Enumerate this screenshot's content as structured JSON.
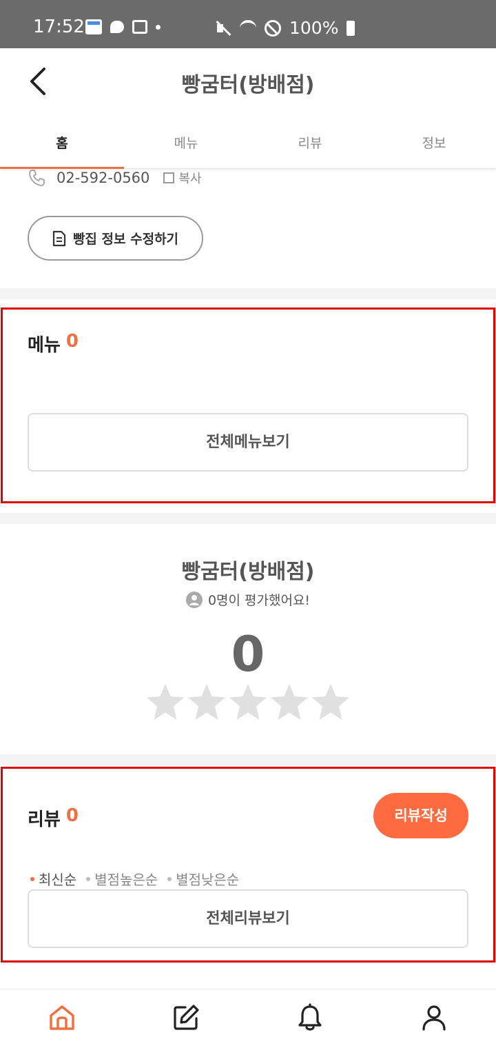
{
  "status_bar": {
    "time": "17:52",
    "battery": "100%",
    "icons": [
      "calendar-icon",
      "chat-bubble-icon",
      "gift-icon",
      "dot-icon",
      "mute-icon",
      "wifi-icon",
      "block-icon",
      "battery-icon"
    ]
  },
  "header": {
    "title": "빵굼터(방배점)",
    "back_icon": "chevron-left-icon"
  },
  "tabs": [
    {
      "label": "홈",
      "active": true
    },
    {
      "label": "메뉴",
      "active": false
    },
    {
      "label": "리뷰",
      "active": false
    },
    {
      "label": "정보",
      "active": false
    }
  ],
  "info": {
    "phone": "02-592-0560",
    "copy_label": "복사",
    "edit_button": "빵집 정보 수정하기"
  },
  "menu_section": {
    "title": "메뉴",
    "count": "0",
    "view_all": "전체메뉴보기"
  },
  "rating_section": {
    "shop_name": "빵굼터(방배점)",
    "rating_count_text": "0명이 평가했어요!",
    "score": "0",
    "stars_filled": 0,
    "stars_total": 5
  },
  "review_section": {
    "title": "리뷰",
    "count": "0",
    "write_button": "리뷰작성",
    "sort_options": [
      {
        "label": "최신순",
        "active": true
      },
      {
        "label": "별점높은순",
        "active": false
      },
      {
        "label": "별점낮은순",
        "active": false
      }
    ],
    "view_all": "전체리뷰보기"
  },
  "bottom_nav": [
    "home-icon",
    "write-icon",
    "bell-icon",
    "profile-icon"
  ],
  "colors": {
    "accent": "#f07040",
    "button_orange": "#ff6b40",
    "highlight_box": "#e00000",
    "star_empty": "#e0e0e0"
  }
}
